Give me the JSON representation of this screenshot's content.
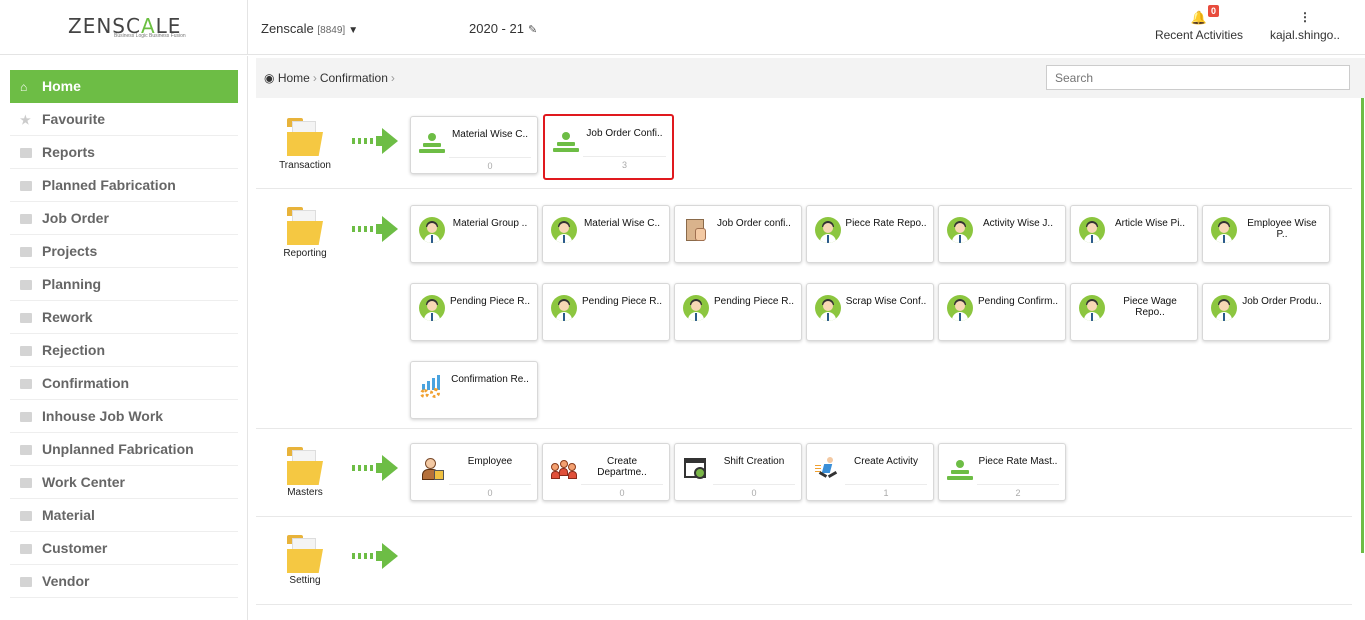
{
  "app": {
    "logo_prefix": "ZENSC",
    "logo_mid": "A",
    "logo_suffix": "LE",
    "tagline": "Business Logic Business Fusion",
    "company": "Zenscale",
    "company_code": "[8849]",
    "year": "2020 - 21",
    "recent_label": "Recent Activities",
    "notifications_count": "0",
    "user": "kajal.shingo.."
  },
  "sidebar": {
    "items": [
      {
        "label": "Home",
        "icon": "home-icon"
      },
      {
        "label": "Favourite",
        "icon": "star-icon"
      },
      {
        "label": "Reports",
        "icon": "document-icon"
      },
      {
        "label": "Planned Fabrication",
        "icon": "folder-icon"
      },
      {
        "label": "Job Order",
        "icon": "folder-icon"
      },
      {
        "label": "Projects",
        "icon": "folder-icon"
      },
      {
        "label": "Planning",
        "icon": "folder-icon"
      },
      {
        "label": "Rework",
        "icon": "folder-icon"
      },
      {
        "label": "Rejection",
        "icon": "folder-icon"
      },
      {
        "label": "Confirmation",
        "icon": "folder-icon"
      },
      {
        "label": "Inhouse Job Work",
        "icon": "folder-icon"
      },
      {
        "label": "Unplanned Fabrication",
        "icon": "folder-icon"
      },
      {
        "label": "Work Center",
        "icon": "folder-icon"
      },
      {
        "label": "Material",
        "icon": "folder-icon"
      },
      {
        "label": "Customer",
        "icon": "folder-icon"
      },
      {
        "label": "Vendor",
        "icon": "folder-icon"
      }
    ]
  },
  "breadcrumb": {
    "home": "Home",
    "current": "Confirmation"
  },
  "search": {
    "placeholder": "Search"
  },
  "sections": {
    "transaction": {
      "label": "Transaction",
      "tiles": [
        {
          "name": "Material Wise C..",
          "count": "0"
        },
        {
          "name": "Job Order Confi..",
          "count": "3"
        }
      ]
    },
    "reporting": {
      "label": "Reporting",
      "tiles": [
        {
          "name": "Material Group .."
        },
        {
          "name": "Material Wise C.."
        },
        {
          "name": "Job Order confi.."
        },
        {
          "name": "Piece Rate Repo.."
        },
        {
          "name": "Activity Wise J.."
        },
        {
          "name": "Article Wise Pi.."
        },
        {
          "name": "Employee Wise P.."
        },
        {
          "name": "Pending Piece R.."
        },
        {
          "name": "Pending Piece R.."
        },
        {
          "name": "Pending Piece R.."
        },
        {
          "name": "Scrap Wise Conf.."
        },
        {
          "name": "Pending Confirm.."
        },
        {
          "name": "Piece Wage Repo.."
        },
        {
          "name": "Job Order Produ.."
        },
        {
          "name": "Confirmation Re.."
        }
      ]
    },
    "masters": {
      "label": "Masters",
      "tiles": [
        {
          "name": "Employee",
          "count": "0"
        },
        {
          "name": "Create Departme..",
          "count": "0"
        },
        {
          "name": "Shift Creation",
          "count": "0"
        },
        {
          "name": "Create Activity",
          "count": "1"
        },
        {
          "name": "Piece Rate Mast..",
          "count": "2"
        }
      ]
    },
    "setting": {
      "label": "Setting"
    }
  },
  "colors": {
    "accent": "#6dbd45",
    "highlight": "#e0191e",
    "badge": "#e84c3d"
  }
}
